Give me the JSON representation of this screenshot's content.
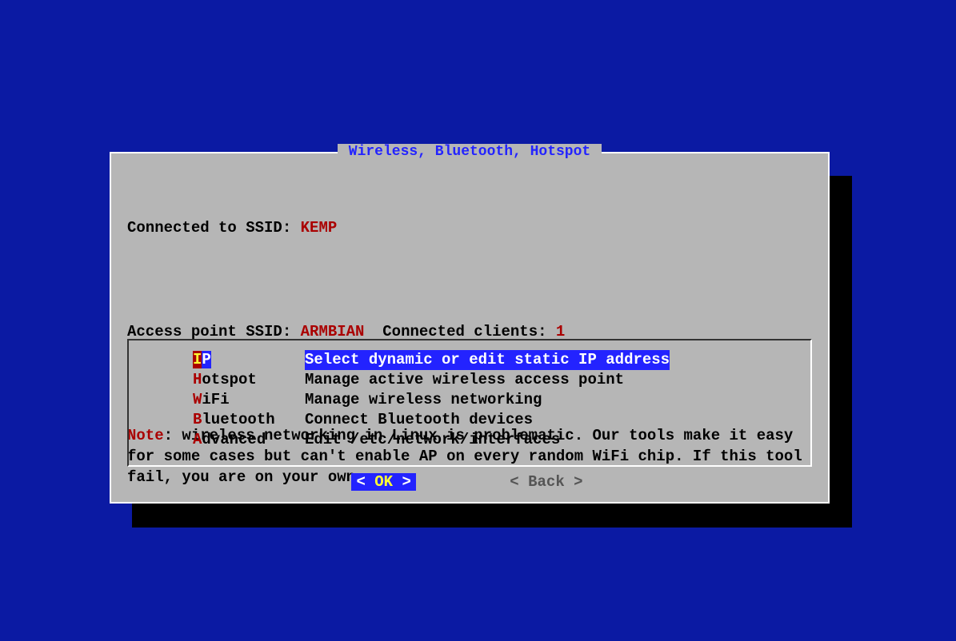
{
  "title": "Wireless, Bluetooth, Hotspot",
  "status": {
    "ssid_prefix": "Connected to SSID: ",
    "ssid": "KEMP",
    "ap_prefix": "Access point SSID: ",
    "ap_ssid": "ARMBIAN",
    "clients_prefix": "  Connected clients: ",
    "clients": "1"
  },
  "note": {
    "label": "Note",
    "text": ": wireless networking in Linux is problematic. Our tools make it easy for some cases but can't enable AP on every random WiFi chip. If this tool fail, you are on your own."
  },
  "menu": [
    {
      "hotkey": "I",
      "rest": "P",
      "desc": "Select dynamic or edit static IP address",
      "selected": true
    },
    {
      "hotkey": "H",
      "rest": "otspot",
      "desc": "Manage active wireless access point",
      "selected": false
    },
    {
      "hotkey": "W",
      "rest": "iFi",
      "desc": "Manage wireless networking",
      "selected": false
    },
    {
      "hotkey": "B",
      "rest": "luetooth",
      "desc": "Connect Bluetooth devices",
      "selected": false
    },
    {
      "hotkey": "A",
      "rest": "dvanced",
      "desc": "Edit /etc/network/interfaces",
      "selected": false
    }
  ],
  "buttons": {
    "ok": "OK",
    "back": "Back"
  }
}
